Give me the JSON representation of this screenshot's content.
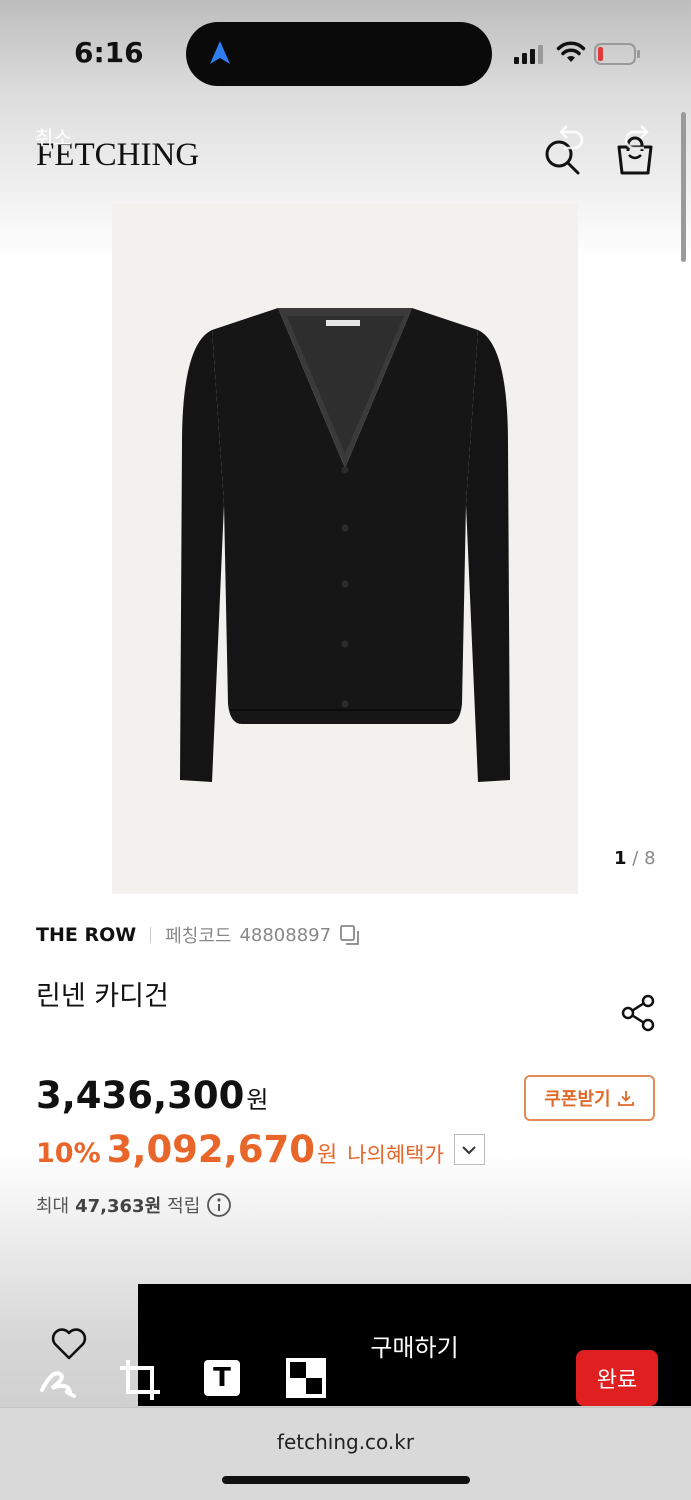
{
  "status_bar": {
    "time": "6:16"
  },
  "editor": {
    "cancel_label": "취소",
    "done_label": "완료"
  },
  "header": {
    "logo": "FETCHING"
  },
  "gallery": {
    "current": "1",
    "total": "8",
    "separator": "/"
  },
  "product": {
    "brand": "THE ROW",
    "code_label": "페칭코드",
    "code": "48808897",
    "name": "린넨 카디건",
    "price": "3,436,300",
    "currency": "원",
    "discount": "10%",
    "sale_price": "3,092,670",
    "benefit_label": "나의혜택가",
    "points_prefix": "최대",
    "points": "47,363원",
    "points_suffix": "적립"
  },
  "coupon": {
    "label": "쿠폰받기"
  },
  "purchase": {
    "buy_label": "구매하기"
  },
  "browser": {
    "url": "fetching.co.kr"
  },
  "colors": {
    "accent": "#e8662a",
    "done_button": "#e02020",
    "buy_bar": "#000000"
  }
}
